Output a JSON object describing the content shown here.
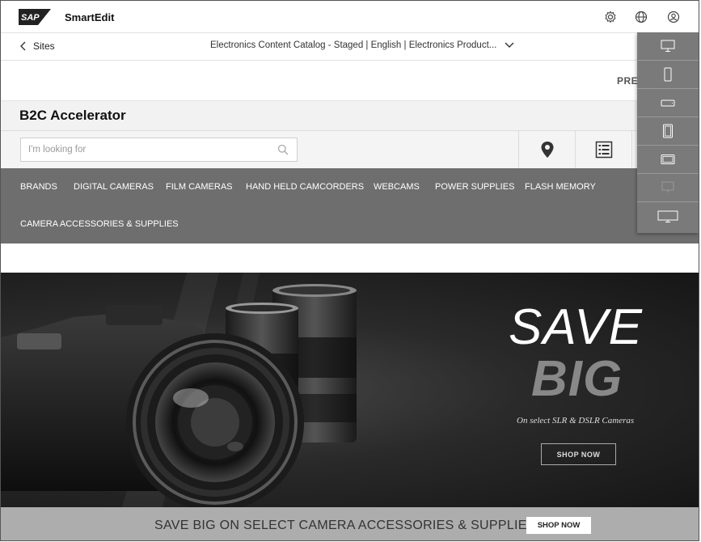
{
  "app": {
    "brand": "SAP",
    "name": "SmartEdit"
  },
  "header_icons": [
    "settings-icon",
    "globe-icon",
    "user-icon"
  ],
  "sites_bar": {
    "back_label": "Sites",
    "catalog_label": "Electronics Content Catalog - Staged | English | Electronics Product..."
  },
  "preview": {
    "label_visible": "PREV"
  },
  "storefront": {
    "title": "B2C Accelerator",
    "search_placeholder": "I'm looking for",
    "utility_icons": [
      "store-locator-icon",
      "list-icon"
    ]
  },
  "nav": {
    "items": [
      "BRANDS",
      "DIGITAL CAMERAS",
      "FILM CAMERAS",
      "HAND HELD CAMCORDERS",
      "WEBCAMS",
      "POWER SUPPLIES",
      "FLASH MEMORY",
      "CAMERA ACCESSORIES & SUPPLIES"
    ]
  },
  "hero": {
    "headline_1": "SAVE",
    "headline_2": "BIG",
    "subtitle": "On select SLR & DSLR Cameras",
    "button": "SHOP NOW"
  },
  "promo": {
    "text": "SAVE BIG ON SELECT CAMERA ACCESSORIES & SUPPLIES",
    "button": "SHOP NOW"
  },
  "device_menu": {
    "items": [
      "desktop-icon",
      "phone-portrait-icon",
      "phone-landscape-icon",
      "tablet-portrait-icon",
      "tablet-landscape-icon",
      "monitor-icon",
      "widescreen-icon"
    ]
  },
  "colors": {
    "nav_bg": "#6e6e6e",
    "device_menu_bg": "#7a7a7a",
    "promo_bg": "#adadad"
  }
}
